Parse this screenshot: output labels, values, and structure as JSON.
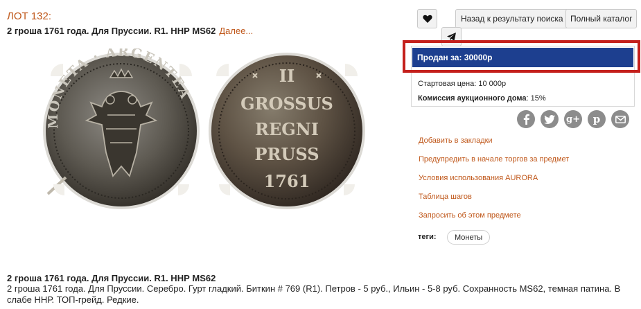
{
  "lot": {
    "number": "ЛОТ 132:",
    "title": "2 гроша 1761 года. Для Пруссии. R1. ННР MS62",
    "more_link": "Далее..."
  },
  "image": {
    "obverse_legend": "MONETA · ARGENTEA",
    "reverse_lines": [
      "II",
      "GROSSUS",
      "REGNI",
      "PRUSS",
      "1761"
    ]
  },
  "toolbar": {
    "favorite_icon": "heart-icon",
    "back_label": "Назад к результату поиска",
    "catalog_label": "Полный каталог",
    "telegram_icon": "telegram-icon"
  },
  "price": {
    "sold_label": "Продан за: 30000р",
    "start_price": "Стартовая цена: 10 000р",
    "commission_label": "Комиссия аукционного дома",
    "commission_value": ": 15%",
    "bar_color": "#1d3f8f",
    "highlight_color": "#c4201c"
  },
  "share": [
    "facebook-icon",
    "twitter-icon",
    "google-plus-icon",
    "pinterest-icon",
    "mail-icon"
  ],
  "actions": [
    "Добавить в закладки",
    "Предупредить в начале торгов за предмет",
    "Условия использования AURORA",
    "Таблица шагов",
    "Запросить об этом предмете"
  ],
  "tags": {
    "label": "теги:",
    "items": [
      "Монеты"
    ]
  },
  "description": {
    "title": "2 гроша 1761 года. Для Пруссии. R1. ННР MS62",
    "text": "2 гроша 1761 года. Для Пруссии. Серебро. Гурт гладкий. Биткин # 769 (R1). Петров - 5 руб., Ильин - 5-8 руб. Сохранность MS62, темная патина. В слабе ННР. ТОП-грейд. Редкие."
  },
  "colors": {
    "accent": "#c0581b",
    "button_bg": "#f2f2f2",
    "share_icon_bg": "#8c8c8c"
  }
}
